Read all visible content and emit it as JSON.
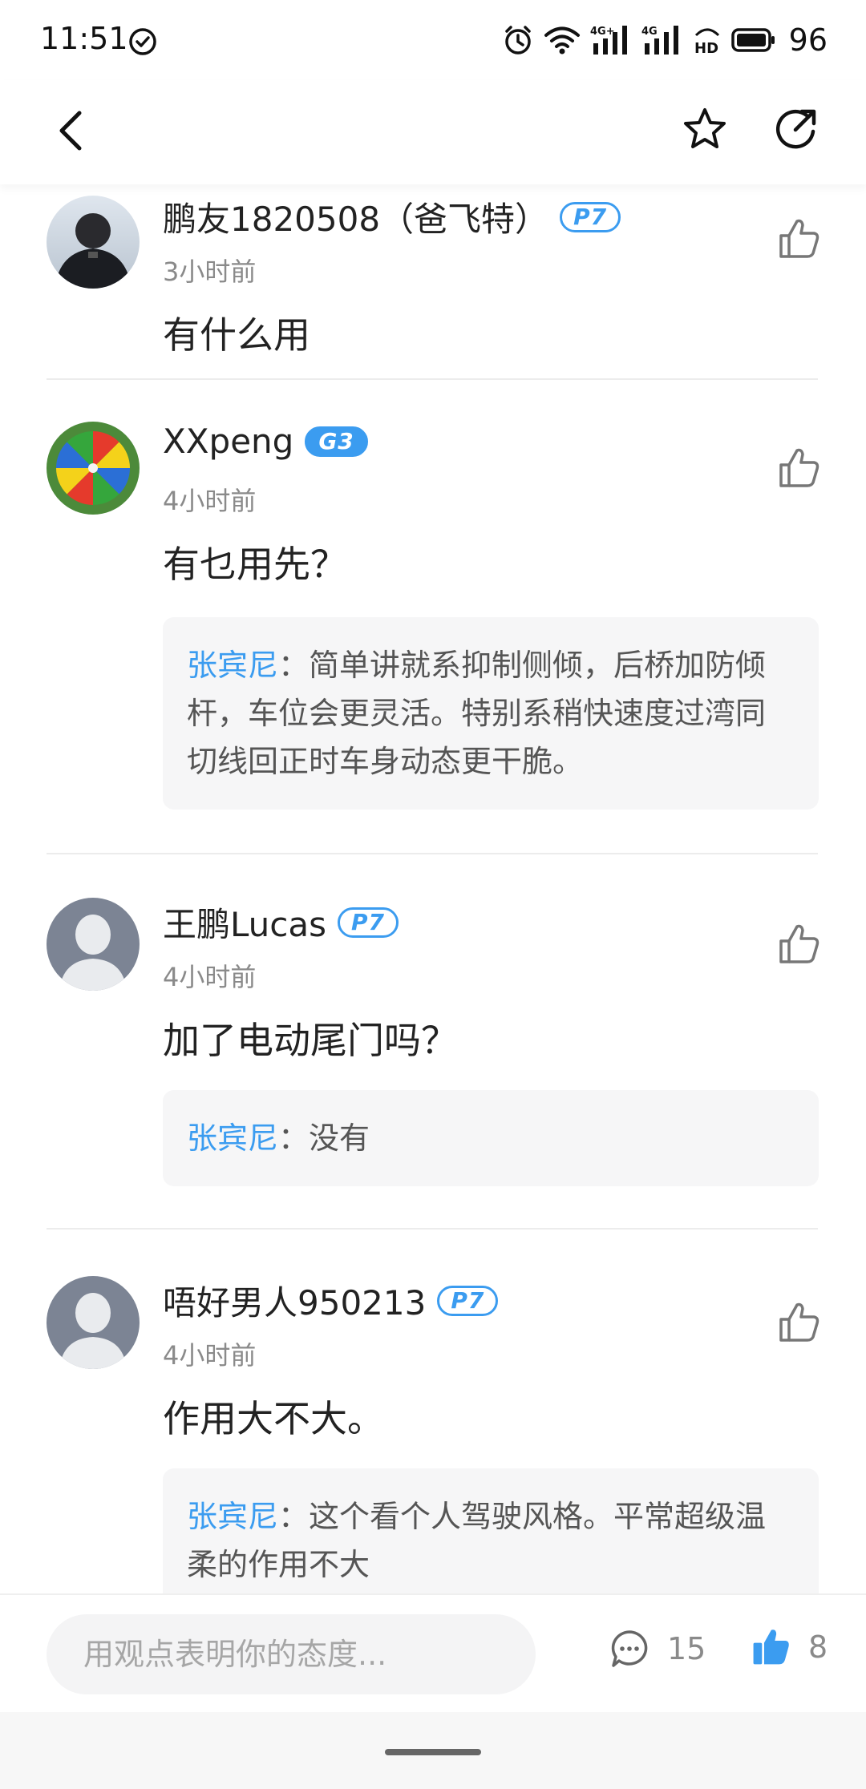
{
  "status_bar": {
    "time": "11:51",
    "battery": "96",
    "network_1": "4G+",
    "network_2": "4G",
    "hd": "HD"
  },
  "toolbar": {
    "back_icon": "chevron-left-icon",
    "favorite_icon": "star-icon",
    "share_icon": "share-icon"
  },
  "comments": [
    {
      "name": "鹏友1820508（爸飞特）",
      "badge": "P7",
      "badge_style": "outline",
      "time": "3小时前",
      "text": "有什么用",
      "avatar": "dark-photo"
    },
    {
      "name": "XXpeng",
      "badge": "G3",
      "badge_style": "filled",
      "time": "4小时前",
      "text": "有乜用先？",
      "avatar": "colorful-umbrella-photo",
      "reply": {
        "author": "张宾尼",
        "text": "：简单讲就系抑制侧倾，后桥加防倾杆，车位会更灵活。特别系稍快速度过湾同切线回正时车身动态更干脆。"
      }
    },
    {
      "name": "王鹏Lucas",
      "badge": "P7",
      "badge_style": "outline",
      "time": "4小时前",
      "text": "加了电动尾门吗？",
      "avatar": "default-avatar",
      "reply": {
        "author": "张宾尼",
        "text": "：没有"
      }
    },
    {
      "name": "唔好男人950213",
      "badge": "P7",
      "badge_style": "outline",
      "time": "4小时前",
      "text": "作用大不大。",
      "avatar": "default-avatar",
      "reply": {
        "author": "张宾尼",
        "text": "：这个看个人驾驶风格。平常超级温柔的作用不大"
      }
    }
  ],
  "bottom_bar": {
    "input_placeholder": "用观点表明你的态度...",
    "comment_count": "15",
    "like_count": "8",
    "accent_color": "#3b9cf0"
  }
}
